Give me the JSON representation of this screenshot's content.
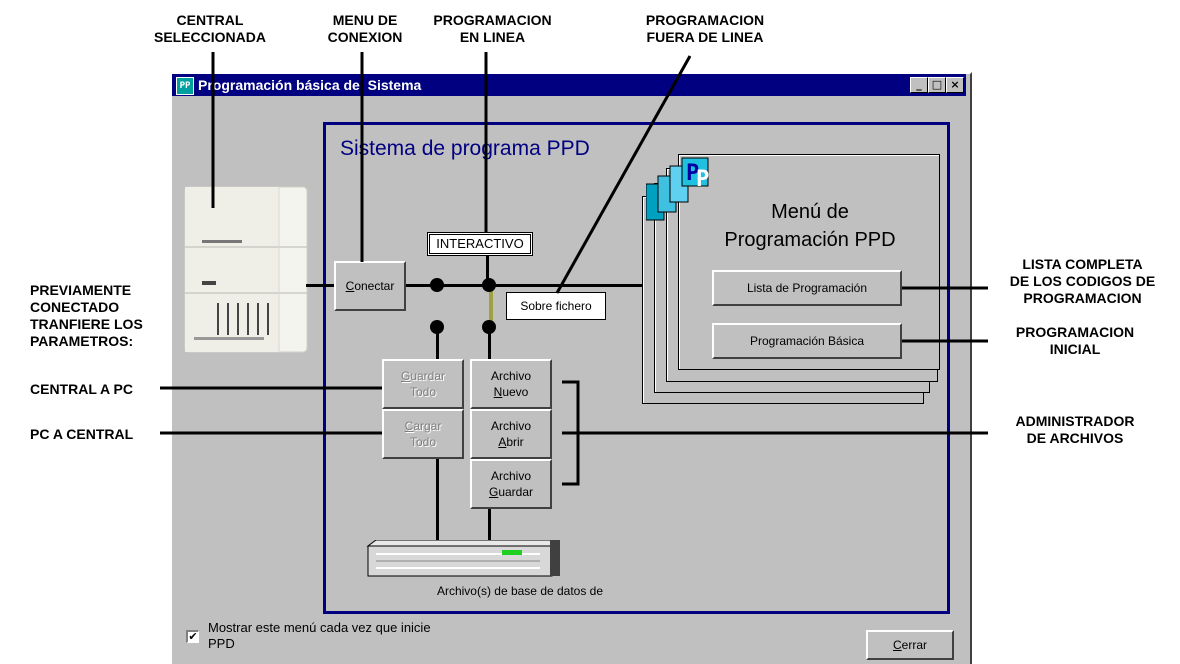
{
  "callouts": {
    "central": [
      "CENTRAL",
      "SELECCIONADA"
    ],
    "menu_conexion": [
      "MENU DE",
      "CONEXION"
    ],
    "prog_linea": [
      "PROGRAMACION",
      "EN LINEA"
    ],
    "prog_fuera": [
      "PROGRAMACION",
      "FUERA DE LINEA"
    ],
    "previamente": [
      "PREVIAMENTE",
      "CONECTADO",
      "TRANFIERE LOS",
      "PARAMETROS:"
    ],
    "central_pc": "CENTRAL A PC",
    "pc_central": "PC A CENTRAL",
    "lista_completa": [
      "LISTA COMPLETA",
      "DE LOS CODIGOS DE",
      "PROGRAMACION"
    ],
    "prog_inicial": [
      "PROGRAMACION",
      "INICIAL"
    ],
    "admin_archivos": [
      "ADMINISTRADOR",
      "DE ARCHIVOS"
    ]
  },
  "window": {
    "title": "Programación básica del Sistema",
    "icon": "app-icon",
    "controls": [
      "_",
      "□",
      "×"
    ]
  },
  "panel": {
    "title": "Sistema de programa PPD",
    "interactivo_label": "INTERACTIVO",
    "conectar": {
      "pre": "",
      "u": "C",
      "post": "onectar"
    },
    "sobre_fichero": "Sobre fichero",
    "guardar_todo": {
      "l1u": "G",
      "l1": "uardar",
      "l2": "Todo"
    },
    "cargar_todo": {
      "l1u": "C",
      "l1": "argar",
      "l2": "Todo"
    },
    "archivo_nuevo": {
      "l1": "Archivo",
      "l2u": "N",
      "l2": "uevo"
    },
    "archivo_abrir": {
      "l1": "Archivo",
      "l2u": "A",
      "l2": "brir"
    },
    "archivo_guardar": {
      "l1": "Archivo",
      "l2u": "G",
      "l2": "uardar"
    },
    "db_label": "Archivo(s) de base de datos de"
  },
  "menu_card": {
    "title1": "Menú de",
    "title2": "Programación PPD",
    "btn_lista": "Lista de Programación",
    "btn_basica": "Programación Básica"
  },
  "footer": {
    "checkbox_checked": true,
    "checkbox_label1": "Mostrar este menú cada vez que inicie",
    "checkbox_label2": "PPD",
    "cerrar": {
      "u": "C",
      "post": "errar"
    }
  },
  "colors": {
    "titlebar": "#000080",
    "window_bg": "#c0c0c0",
    "panel_border": "#000080",
    "olive_line": "#a0a040"
  }
}
